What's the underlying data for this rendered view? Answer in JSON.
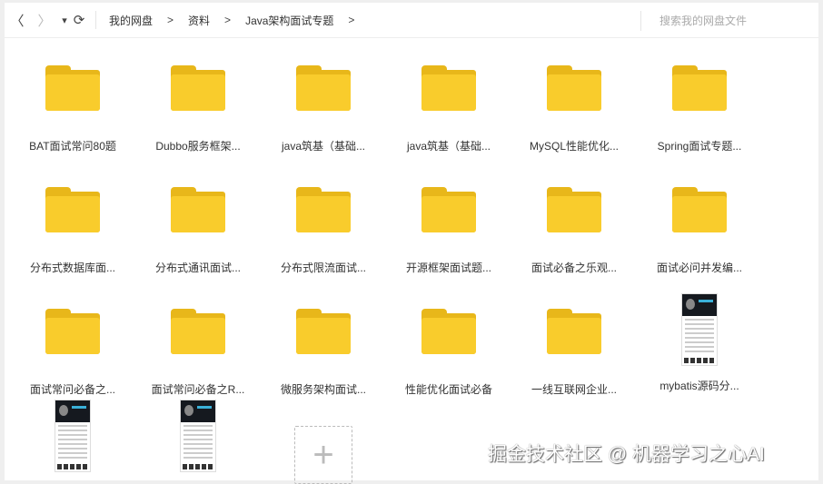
{
  "toolbar": {
    "back": "〈",
    "forward": "〉",
    "dropdown": "▾",
    "refresh": "⟳",
    "breadcrumb": [
      "我的网盘",
      "资料",
      "Java架构面试专题"
    ],
    "chevron": ">",
    "search_placeholder": "搜索我的网盘文件"
  },
  "items": [
    {
      "name": "BAT面试常问80题",
      "type": "folder"
    },
    {
      "name": "Dubbo服务框架...",
      "type": "folder"
    },
    {
      "name": "java筑基（基础...",
      "type": "folder"
    },
    {
      "name": "java筑基（基础...",
      "type": "folder"
    },
    {
      "name": "MySQL性能优化...",
      "type": "folder"
    },
    {
      "name": "Spring面试专题...",
      "type": "folder"
    },
    {
      "name": "分布式数据库面...",
      "type": "folder"
    },
    {
      "name": "分布式通讯面试...",
      "type": "folder"
    },
    {
      "name": "分布式限流面试...",
      "type": "folder"
    },
    {
      "name": "开源框架面试题...",
      "type": "folder"
    },
    {
      "name": "面试必备之乐观...",
      "type": "folder"
    },
    {
      "name": "面试必问并发编...",
      "type": "folder"
    },
    {
      "name": "面试常问必备之...",
      "type": "folder"
    },
    {
      "name": "面试常问必备之R...",
      "type": "folder"
    },
    {
      "name": "微服务架构面试...",
      "type": "folder"
    },
    {
      "name": "性能优化面试必备",
      "type": "folder"
    },
    {
      "name": "一线互联网企业...",
      "type": "folder"
    },
    {
      "name": "mybatis源码分...",
      "type": "doc"
    },
    {
      "name": "",
      "type": "doc"
    },
    {
      "name": "",
      "type": "doc"
    }
  ],
  "add_button": "+",
  "watermark": "掘金技术社区 @ 机器学习之心AI"
}
